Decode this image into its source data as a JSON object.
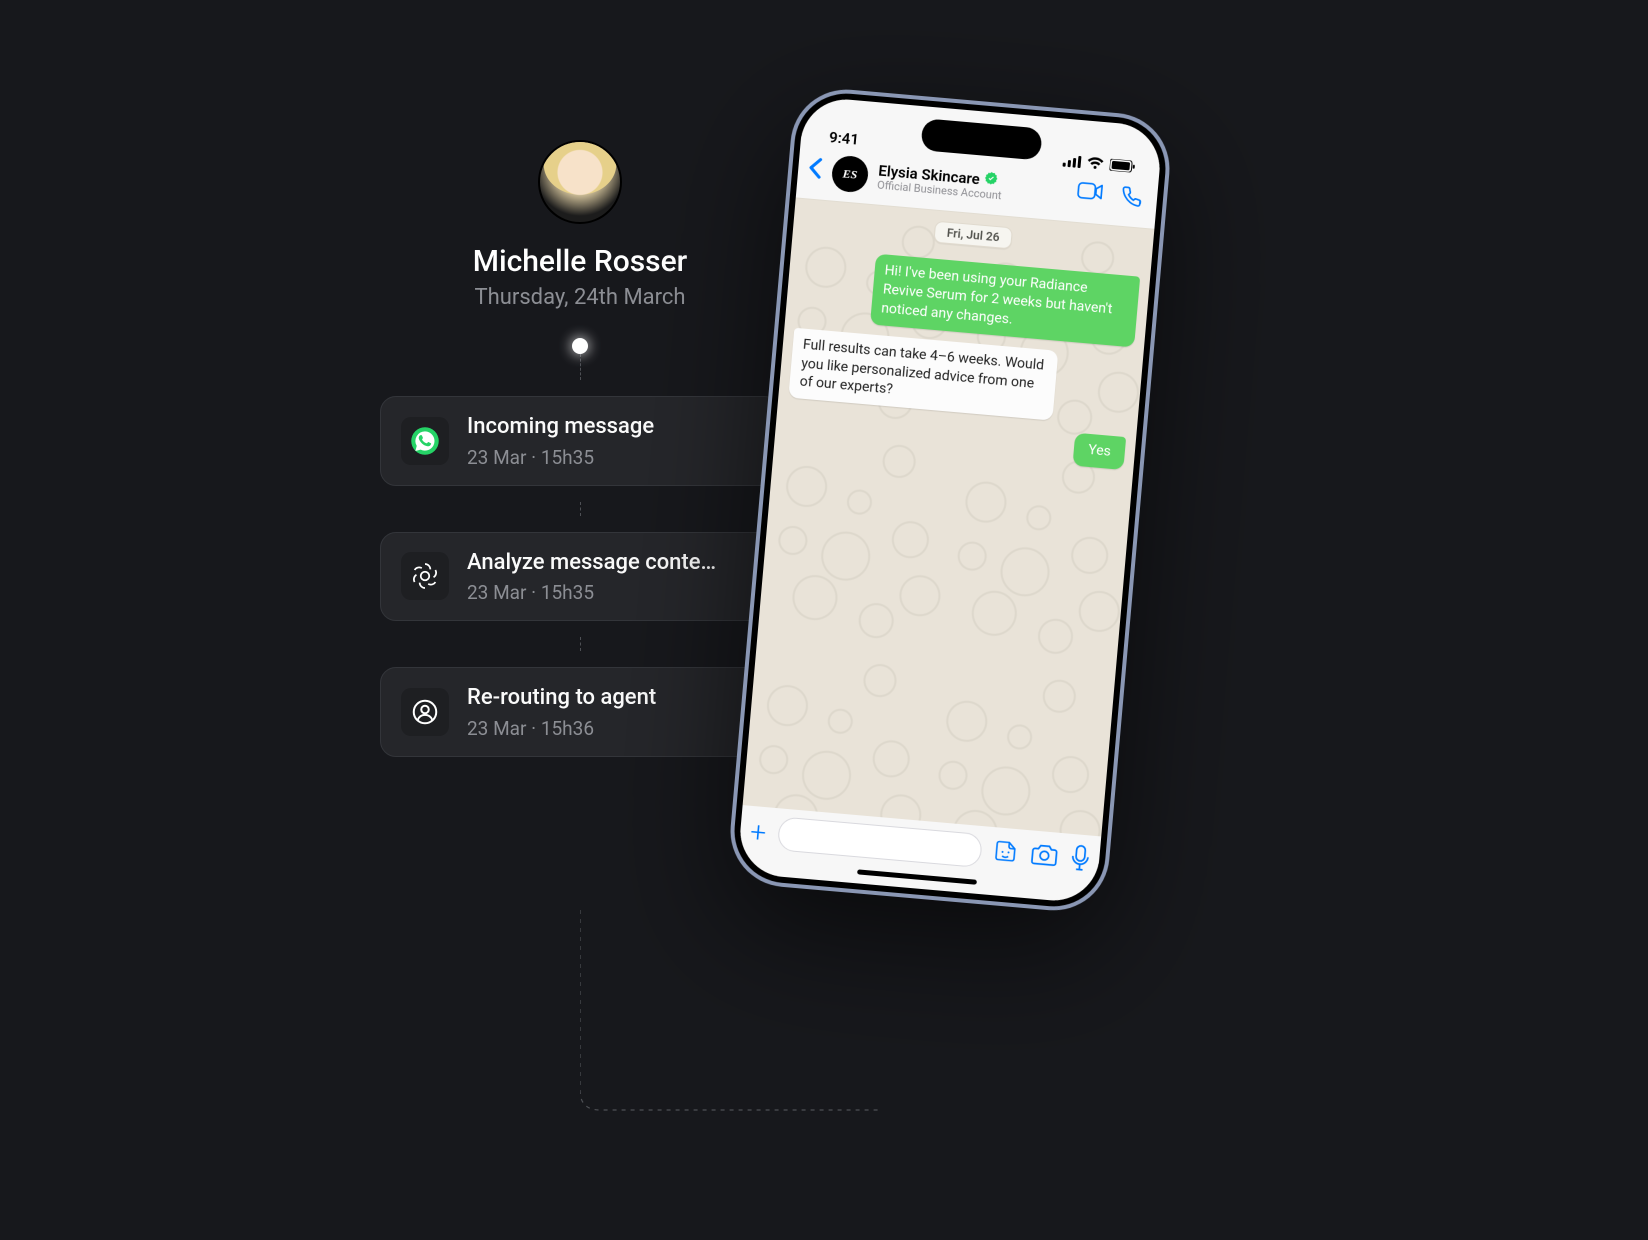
{
  "person": {
    "name": "Michelle Rosser",
    "date": "Thursday, 24th March"
  },
  "timeline": [
    {
      "icon": "whatsapp",
      "title": "Incoming message",
      "sub": "23 Mar · 15h35"
    },
    {
      "icon": "openai",
      "title": "Analyze message conte…",
      "sub": "23 Mar · 15h35"
    },
    {
      "icon": "agent",
      "title": "Re-routing to agent",
      "sub": "23 Mar · 15h36"
    }
  ],
  "phone": {
    "status": {
      "time": "9:41"
    },
    "contact": {
      "avatar_text": "ES",
      "name": "Elysia Skincare",
      "subtitle": "Official Business Account"
    },
    "chat": {
      "date_label": "Fri, Jul 26",
      "messages": [
        {
          "dir": "out",
          "text": "Hi! I've been using your Radiance Revive Serum for 2 weeks but haven't noticed any changes."
        },
        {
          "dir": "in",
          "text": "Full results can take 4–6 weeks. Would you like personalized advice from one of our experts?"
        },
        {
          "dir": "out",
          "text": "Yes",
          "small": true
        }
      ]
    }
  }
}
